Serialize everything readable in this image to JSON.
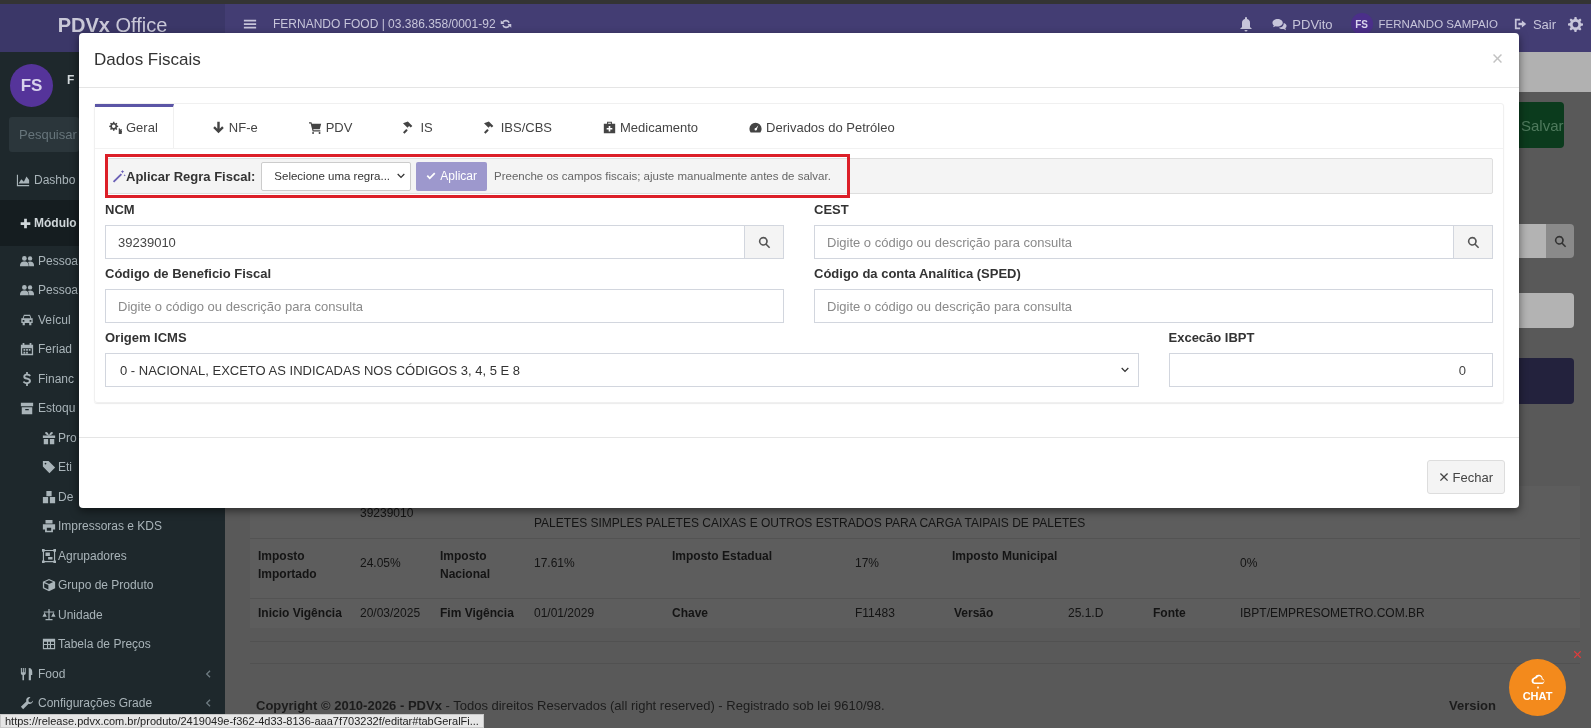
{
  "topbar": {
    "logo": "**PDVx** Office",
    "company": "FERNANDO FOOD | 03.386.358/0001-92",
    "assistant": "PDVito",
    "user_initials": "FS",
    "user_name": "FERNANDO SAMPAIO",
    "logout": "Sair"
  },
  "sidebar": {
    "avatar_initials": "FS",
    "user_name": "F",
    "search_placeholder": "Pesquisar",
    "items": [
      {
        "label": "Dashbo",
        "kind": "item"
      },
      {
        "label": "Módulo",
        "kind": "header"
      },
      {
        "label": "Pessoa",
        "kind": "sub"
      },
      {
        "label": "Pessoa",
        "kind": "sub"
      },
      {
        "label": "Veícul",
        "kind": "sub"
      },
      {
        "label": "Feriad",
        "kind": "sub"
      },
      {
        "label": "Financ",
        "kind": "sub"
      },
      {
        "label": "Estoqu",
        "kind": "sub"
      },
      {
        "label": "Pro",
        "kind": "subsub"
      },
      {
        "label": "Eti",
        "kind": "subsub"
      },
      {
        "label": "De",
        "kind": "subsub"
      },
      {
        "label": "Impressoras e KDS",
        "kind": "subsub"
      },
      {
        "label": "Agrupadores",
        "kind": "subsub"
      },
      {
        "label": "Grupo de Produto",
        "kind": "subsub"
      },
      {
        "label": "Unidade",
        "kind": "subsub"
      },
      {
        "label": "Tabela de Preços",
        "kind": "subsub"
      },
      {
        "label": "Food",
        "kind": "group"
      },
      {
        "label": "Configurações Grade",
        "kind": "group"
      }
    ]
  },
  "page": {
    "save_button": "Salvar",
    "tax_table": {
      "rows": [
        [
          {
            "text": "",
            "kind": "empty"
          },
          {
            "text": "39239010",
            "kind": "value"
          },
          {
            "text": "",
            "kind": "empty"
          },
          {
            "text": "PALETES SIMPLES PALETES CAIXAS E OUTROS ESTRADOS PARA CARGA TAIPAIS DE PALETES",
            "kind": "value"
          }
        ],
        [
          {
            "text": "Imposto Importado",
            "kind": "label"
          },
          {
            "text": "24.05%",
            "kind": "value"
          },
          {
            "text": "Imposto Nacional",
            "kind": "label"
          },
          {
            "text": "17.61%",
            "kind": "value"
          },
          {
            "text": "Imposto Estadual",
            "kind": "label"
          },
          {
            "text": "17%",
            "kind": "value"
          },
          {
            "text": "Imposto Municipal",
            "kind": "label"
          },
          {
            "text": "",
            "kind": "empty"
          },
          {
            "text": "",
            "kind": "empty"
          },
          {
            "text": "0%",
            "kind": "value"
          }
        ],
        [
          {
            "text": "Inicio Vigência",
            "kind": "label"
          },
          {
            "text": "20/03/2025",
            "kind": "value"
          },
          {
            "text": "Fim Vigência",
            "kind": "label"
          },
          {
            "text": "01/01/2029",
            "kind": "value"
          },
          {
            "text": "Chave",
            "kind": "label"
          },
          {
            "text": "F11483",
            "kind": "value"
          },
          {
            "text": "Versão",
            "kind": "label"
          },
          {
            "text": "25.1.D",
            "kind": "value"
          },
          {
            "text": "Fonte",
            "kind": "label"
          },
          {
            "text": "IBPT/EMPRESOMETRO.COM.BR",
            "kind": "value"
          }
        ]
      ]
    },
    "footer": {
      "copyright": "**Copyright © 2010-2026 - PDVx** - Todos direitos Reservados (all right reserved) - Registrado sob lei 9610/98.",
      "version": "Version"
    }
  },
  "modal": {
    "title": "Dados Fiscais",
    "tabs": [
      {
        "label": "Geral",
        "selected": true
      },
      {
        "label": "NF-e",
        "selected": false
      },
      {
        "label": "PDV",
        "selected": false
      },
      {
        "label": "IS",
        "selected": false
      },
      {
        "label": "IBS/CBS",
        "selected": false
      },
      {
        "label": "Medicamento",
        "selected": false
      },
      {
        "label": "Derivados do Petróleo",
        "selected": false
      }
    ],
    "rule_bar": {
      "label": "Aplicar Regra Fiscal:",
      "select": "Selecione uma regra...",
      "button": "Aplicar",
      "hint": "Preenche os campos fiscais; ajuste manualmente antes de salvar.",
      "highlighted": true
    },
    "fields": [
      {
        "label": "NCM",
        "value": "39239010",
        "kind": "search"
      },
      {
        "label": "CEST",
        "placeholder": "Digite o código ou descrição para consulta",
        "kind": "search"
      },
      {
        "label": "Código de Beneficio Fiscal",
        "placeholder": "Digite o código ou descrição para consulta",
        "kind": "text"
      },
      {
        "label": "Código da conta Analítica (SPED)",
        "placeholder": "Digite o código ou descrição para consulta",
        "kind": "text"
      },
      {
        "label": "Origem ICMS",
        "value": "0 - NACIONAL, EXCETO AS INDICADAS NOS CÓDIGOS 3, 4, 5 E 8",
        "kind": "select"
      },
      {
        "label": "Excecão IBPT",
        "value": "0",
        "kind": "number"
      }
    ],
    "close_button": "Fechar"
  },
  "status_url": "https://release.pdvx.com.br/produto/2419049e-f362-4d33-8136-aaa7f703232f/editar#tabGeralFi...",
  "chat": {
    "label": "CHAT"
  }
}
